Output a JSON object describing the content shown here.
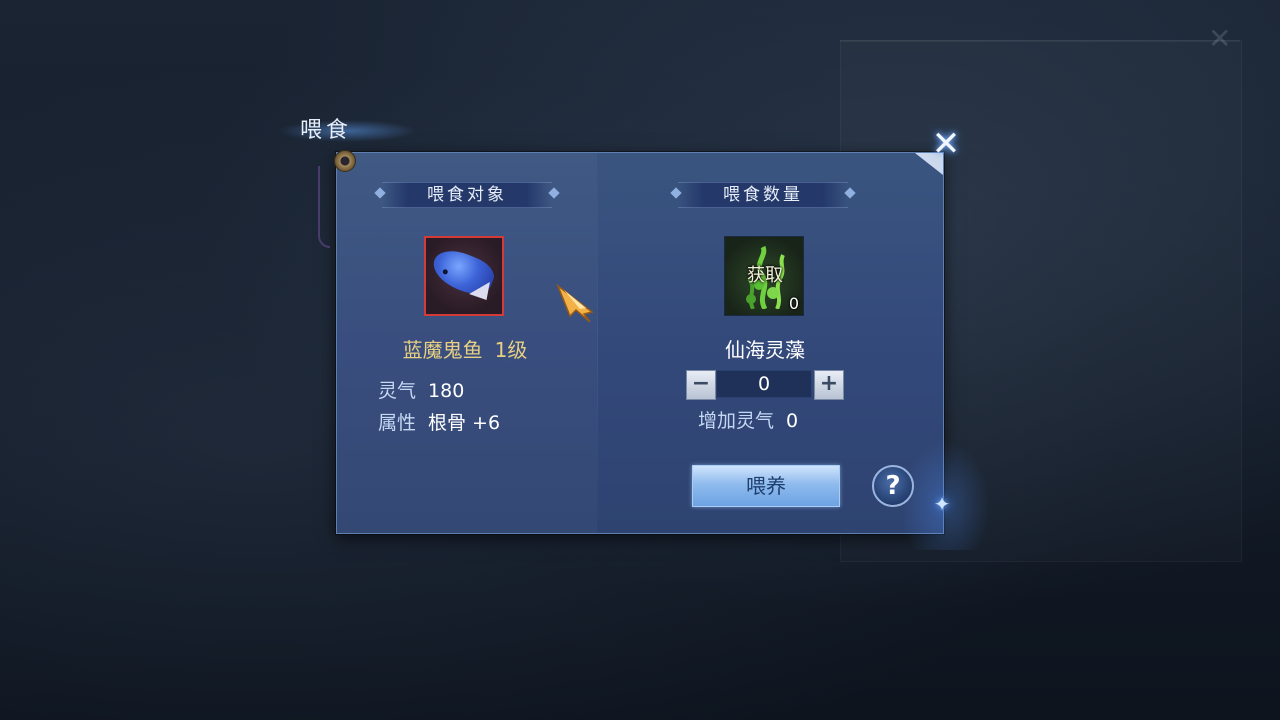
{
  "window": {
    "title": "喂食"
  },
  "left_section": {
    "header": "喂食对象",
    "pet": {
      "icon": "blue-fish-icon",
      "name": "蓝魔鬼鱼",
      "level": "1级",
      "stats": [
        {
          "label": "灵气",
          "value": "180"
        },
        {
          "label": "属性",
          "value": "根骨 +6"
        }
      ]
    }
  },
  "right_section": {
    "header": "喂食数量",
    "food": {
      "icon": "seaweed-icon",
      "overlay_label": "获取",
      "owned_count": "0",
      "name": "仙海灵藻"
    },
    "quantity": {
      "minus": "−",
      "value": "0",
      "plus": "+"
    },
    "increase": {
      "label": "增加灵气",
      "value": "0"
    }
  },
  "buttons": {
    "feed": "喂养",
    "help": "?",
    "close": "✕"
  },
  "colors": {
    "pet_name": "#e8cf84",
    "feed_button": "#8fbbee",
    "slot_border_selected": "#d43a3a"
  }
}
